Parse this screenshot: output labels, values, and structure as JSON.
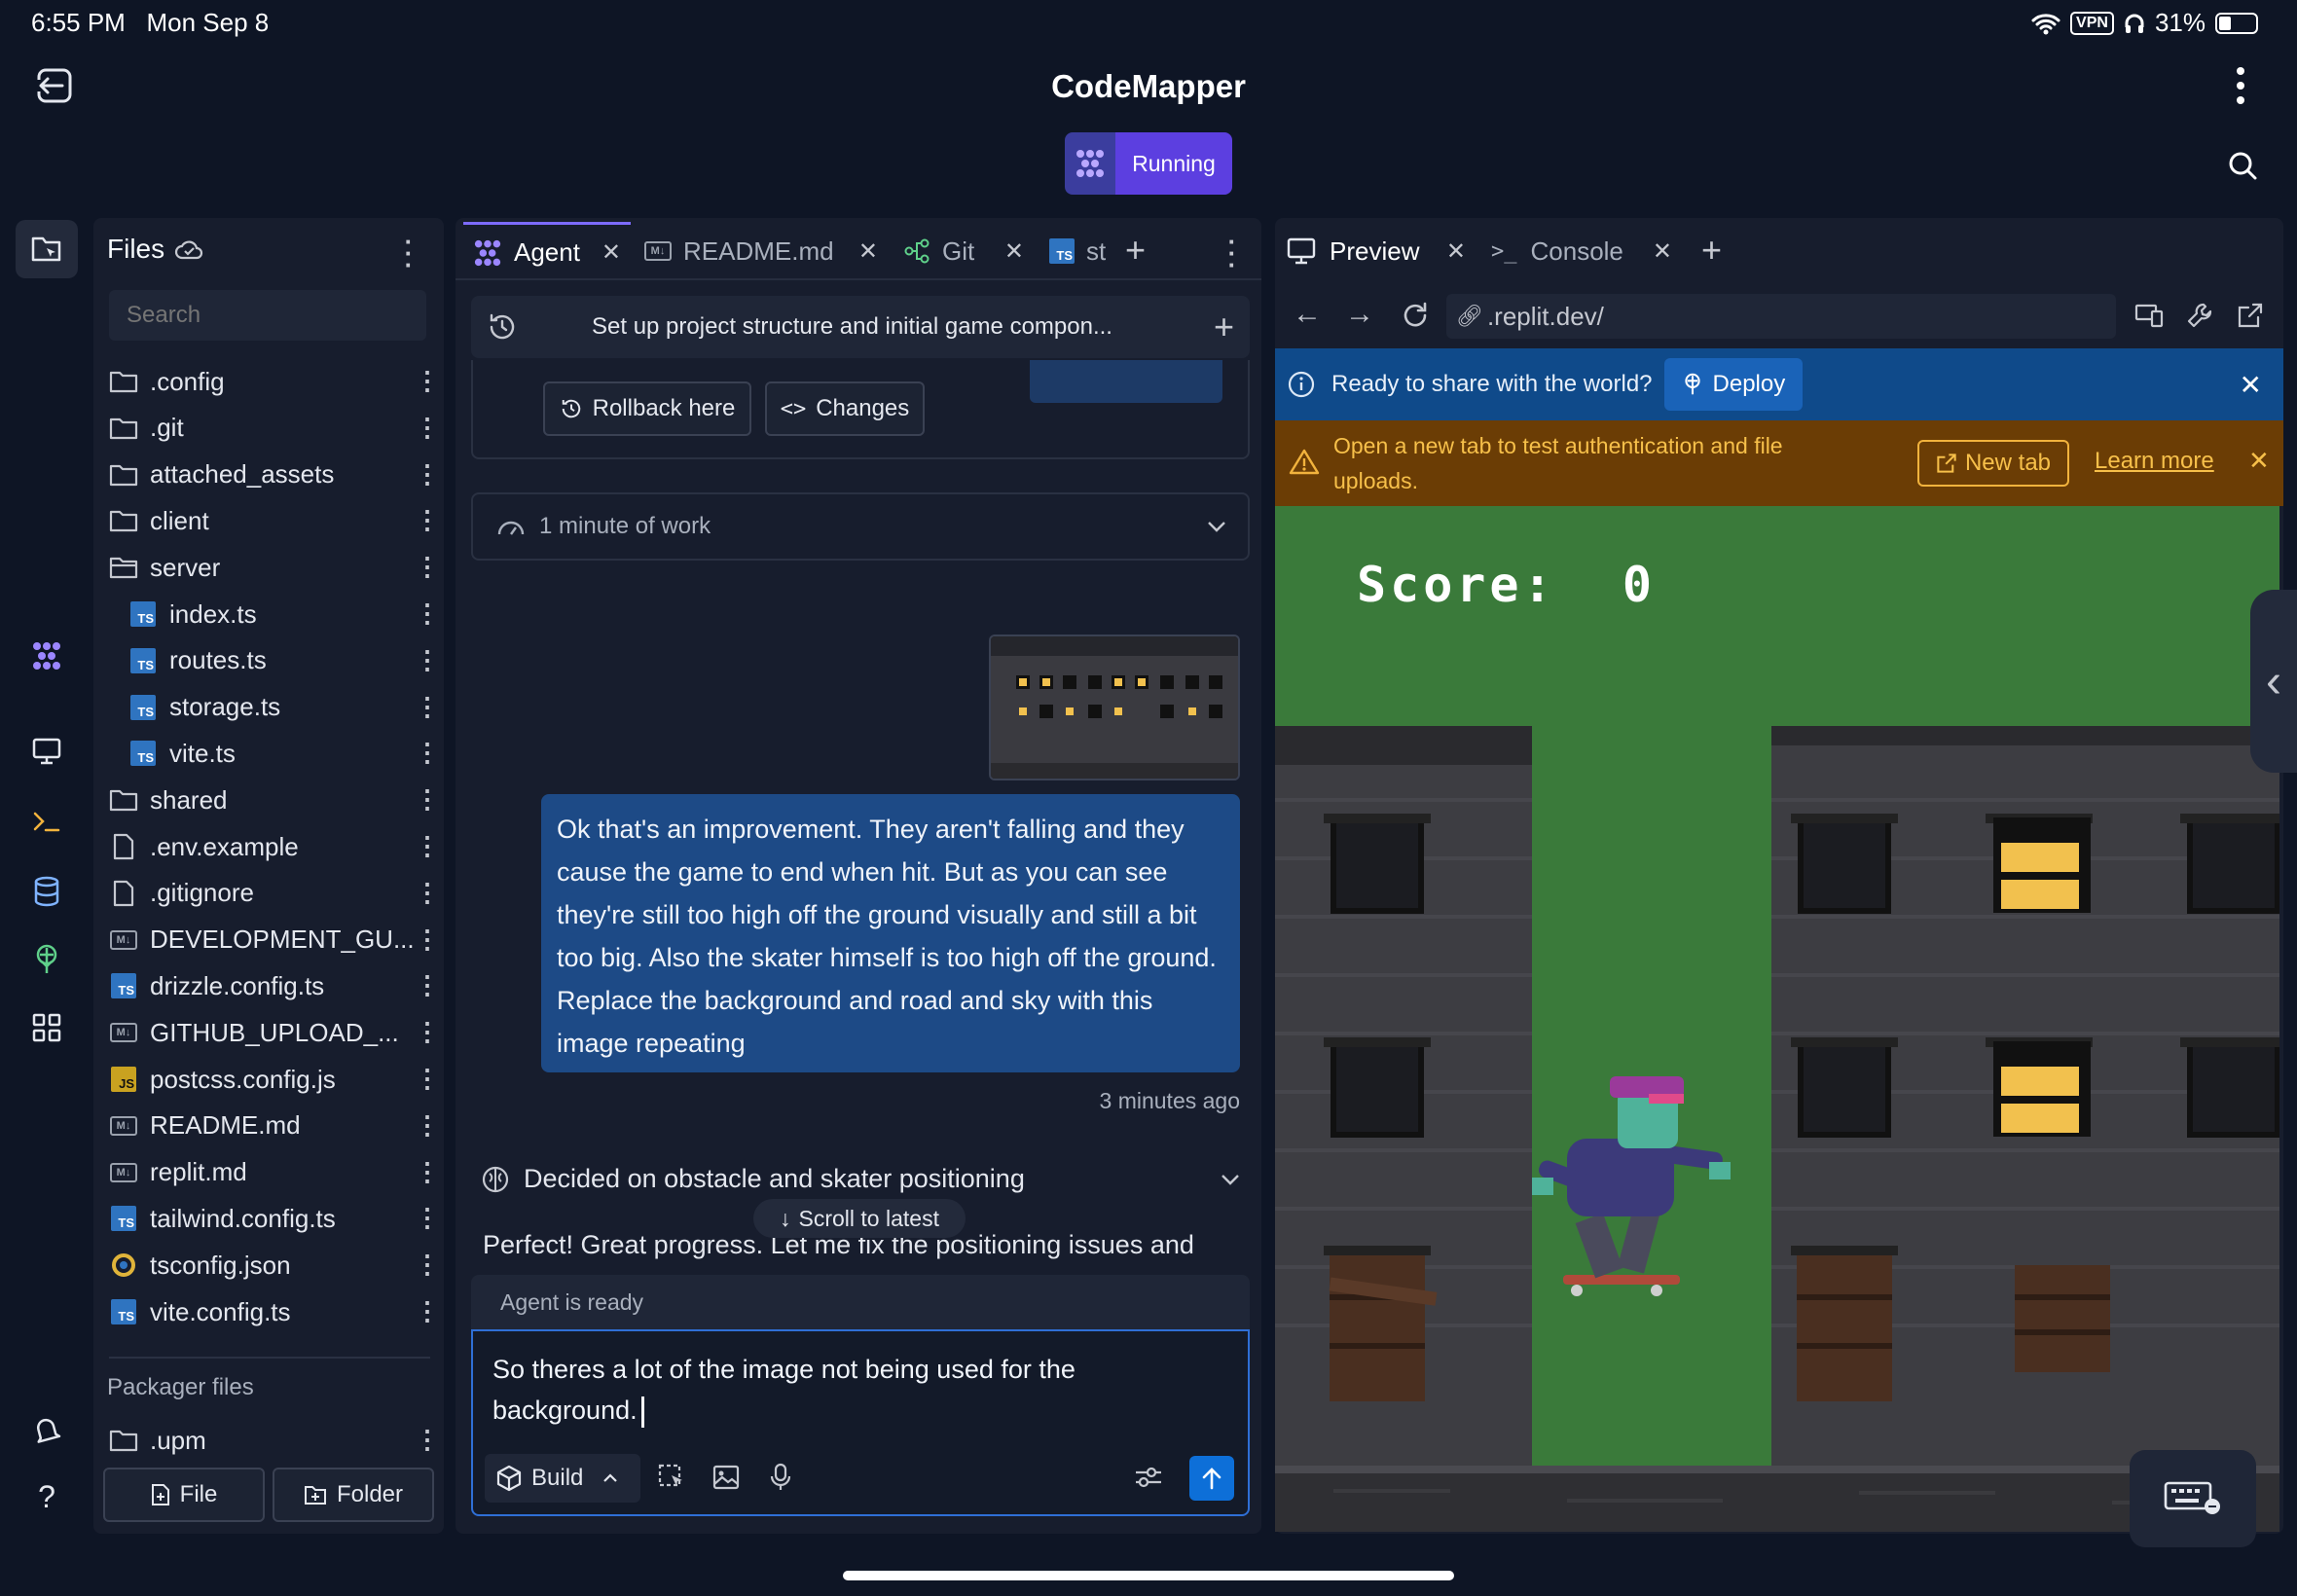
{
  "status_bar": {
    "time": "6:55 PM",
    "date": "Mon Sep 8",
    "vpn": "VPN",
    "battery": "31%"
  },
  "header": {
    "title": "CodeMapper",
    "run_label": "Running"
  },
  "files": {
    "title": "Files",
    "search_placeholder": "Search",
    "items": [
      {
        "name": ".config",
        "type": "folder"
      },
      {
        "name": ".git",
        "type": "folder"
      },
      {
        "name": "attached_assets",
        "type": "folder"
      },
      {
        "name": "client",
        "type": "folder"
      },
      {
        "name": "server",
        "type": "folder-open"
      },
      {
        "name": "index.ts",
        "type": "ts"
      },
      {
        "name": "routes.ts",
        "type": "ts"
      },
      {
        "name": "storage.ts",
        "type": "ts"
      },
      {
        "name": "vite.ts",
        "type": "ts"
      },
      {
        "name": "shared",
        "type": "folder"
      },
      {
        "name": ".env.example",
        "type": "file"
      },
      {
        "name": ".gitignore",
        "type": "file"
      },
      {
        "name": "DEVELOPMENT_GU...",
        "type": "md"
      },
      {
        "name": "drizzle.config.ts",
        "type": "ts"
      },
      {
        "name": "GITHUB_UPLOAD_...",
        "type": "md"
      },
      {
        "name": "postcss.config.js",
        "type": "js"
      },
      {
        "name": "README.md",
        "type": "md"
      },
      {
        "name": "replit.md",
        "type": "md"
      },
      {
        "name": "tailwind.config.ts",
        "type": "ts"
      },
      {
        "name": "tsconfig.json",
        "type": "json"
      },
      {
        "name": "vite.config.ts",
        "type": "ts"
      }
    ],
    "packager_title": "Packager files",
    "packager_items": [
      {
        "name": ".upm",
        "type": "folder"
      }
    ],
    "new_file_label": "File",
    "new_folder_label": "Folder"
  },
  "editor_tabs": [
    {
      "label": "Agent",
      "active": true
    },
    {
      "label": "README.md"
    },
    {
      "label": "Git"
    },
    {
      "label": "st"
    }
  ],
  "agent": {
    "task_title": "Set up project structure and initial game compon...",
    "rollback_label": "Rollback here",
    "changes_label": "Changes",
    "work_summary": "1 minute of work",
    "user_message": "Ok that's an improvement. They aren't falling and they cause the game to end when hit. But as you can see they're still too high off the ground visually and still a bit too big. Also the skater himself is too high off the ground. Replace the background and road and sky with this image repeating",
    "message_time": "3 minutes ago",
    "decision": "Decided on obstacle and skater positioning",
    "scroll_label": "Scroll to latest",
    "response_preview": "Perfect! Great progress. Let me fix the positioning issues and",
    "status": "Agent is ready",
    "input_text": "So theres a lot of the image not being used for the background.",
    "mode_label": "Build"
  },
  "preview_tabs": [
    {
      "label": "Preview",
      "active": true
    },
    {
      "label": "Console"
    }
  ],
  "preview": {
    "url": ".replit.dev/",
    "deploy_banner": "Ready to share with the world?",
    "deploy_label": "Deploy",
    "warn_banner": "Open a new tab to test authentication and file uploads.",
    "new_tab_label": "New tab",
    "learn_more_label": "Learn more",
    "score_label": "Score:",
    "score_value": "0"
  },
  "colors": {
    "background": "#0e1525",
    "panel": "#171d2d",
    "accent": "#5c3fe0",
    "user_bubble": "#1d4a86",
    "deploy_banner": "#0f4a8a",
    "warn_banner": "#6b3d05",
    "game_sky": "#3a7a3a",
    "send_button": "#0d6fd8"
  }
}
